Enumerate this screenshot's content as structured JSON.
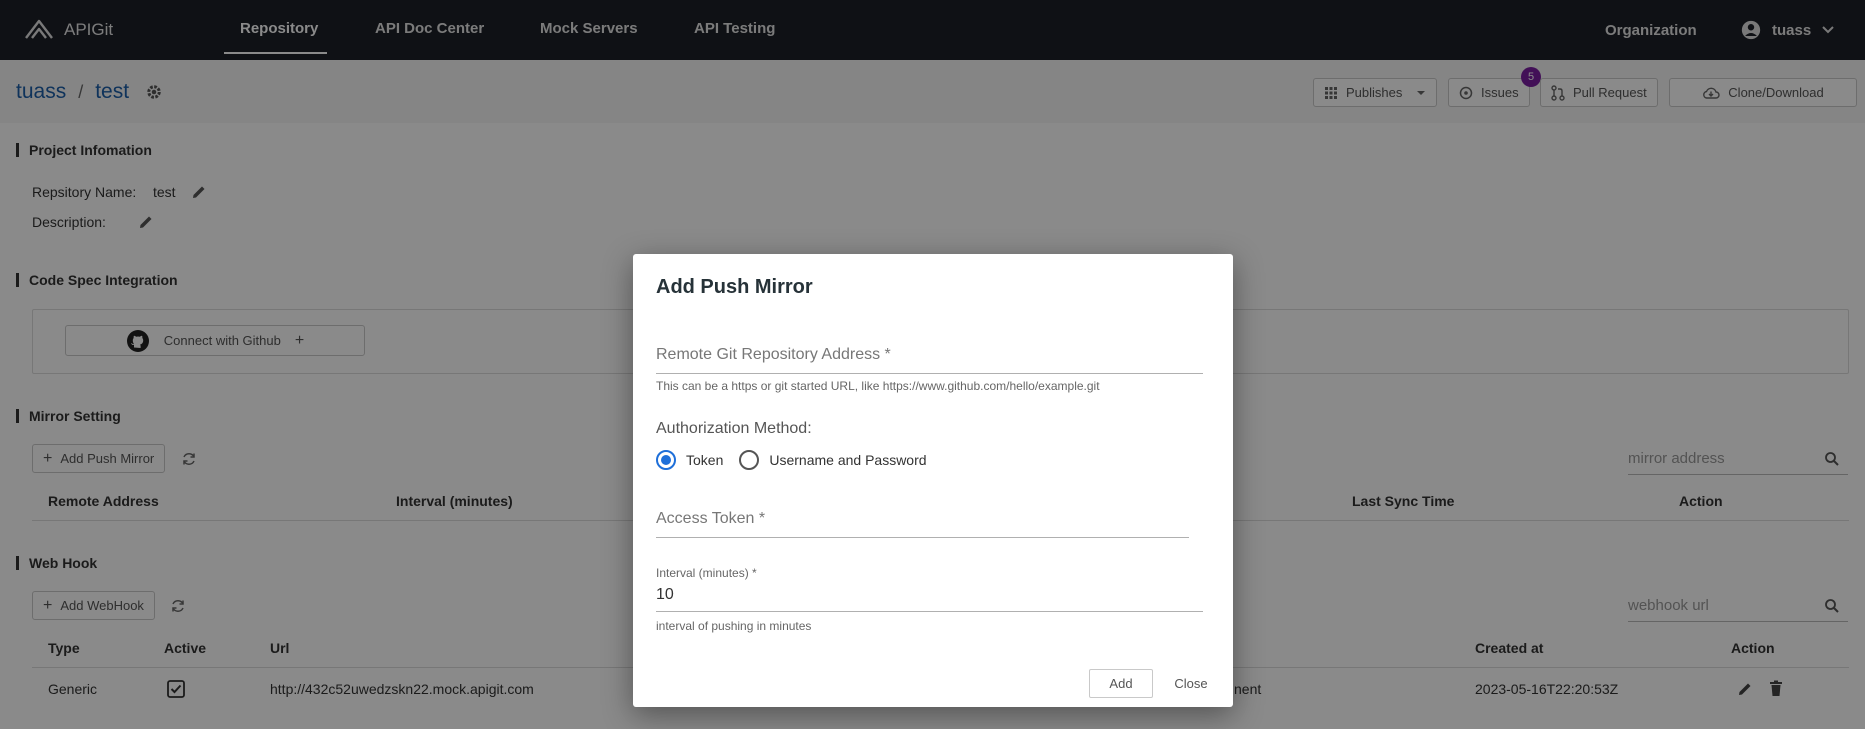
{
  "app": {
    "name": "APIGit"
  },
  "nav": {
    "tabs": [
      {
        "label": "Repository"
      },
      {
        "label": "API Doc Center"
      },
      {
        "label": "Mock Servers"
      },
      {
        "label": "API Testing"
      }
    ],
    "organization": "Organization",
    "user": "tuass"
  },
  "breadcrumb": {
    "owner": "tuass",
    "sep": "/",
    "repo": "test"
  },
  "header_buttons": {
    "publishes": "Publishes",
    "issues": "Issues",
    "issues_count": "5",
    "pull_request": "Pull Request",
    "clone": "Clone/Download"
  },
  "project": {
    "title": "Project Infomation",
    "repo_name_label": "Repsitory Name:",
    "repo_name_value": "test",
    "description_label": "Description:"
  },
  "code_spec": {
    "title": "Code Spec Integration",
    "connect_label": "Connect with Github"
  },
  "mirror": {
    "title": "Mirror Setting",
    "add_label": "Add Push Mirror",
    "search_placeholder": "mirror address",
    "columns": [
      "Remote Address",
      "Interval (minutes)",
      "Last Sync Time",
      "Action"
    ]
  },
  "webhook": {
    "title": "Web Hook",
    "add_label": "Add WebHook",
    "search_placeholder": "webhook url",
    "columns": [
      "Type",
      "Active",
      "Url",
      "Created at",
      "Action"
    ],
    "rows": [
      {
        "type": "Generic",
        "active": true,
        "url": "http://432c52uwedzskn22.mock.apigit.com",
        "events": "nent",
        "created_at": "2023-05-16T22:20:53Z"
      }
    ]
  },
  "dialog": {
    "title": "Add Push Mirror",
    "remote_placeholder": "Remote Git Repository Address *",
    "remote_hint": "This can be a https or git started URL, like https://www.github.com/hello/example.git",
    "auth_label": "Authorization Method:",
    "auth_options": [
      "Token",
      "Username and Password"
    ],
    "auth_selected": "Token",
    "token_placeholder": "Access Token *",
    "interval_label": "Interval (minutes) *",
    "interval_value": "10",
    "interval_hint": "interval of pushing in minutes",
    "add_label": "Add",
    "close_label": "Close"
  },
  "colors": {
    "topbar": "#1c2128",
    "link": "#1d5fa8",
    "badge": "#7b1fa2",
    "radio": "#1e6fd9"
  }
}
